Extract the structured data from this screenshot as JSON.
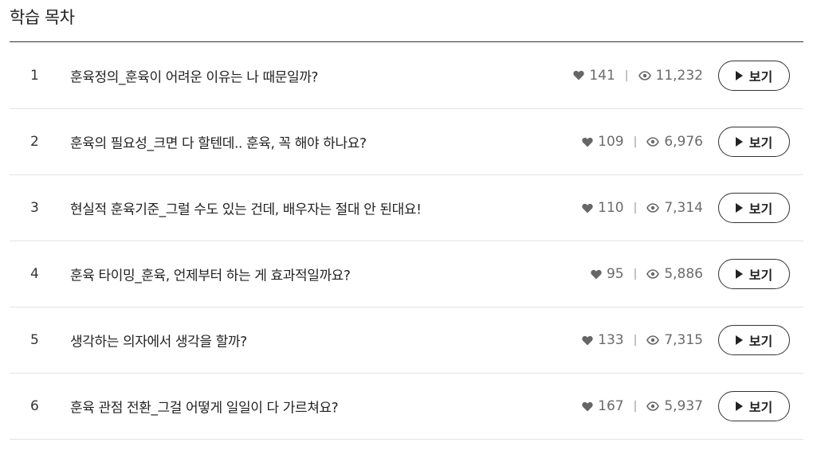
{
  "section": {
    "title": "학습 목차"
  },
  "lessons": [
    {
      "number": "1",
      "title": "훈육정의_훈육이 어려운 이유는 나 때문일까?",
      "likes": "141",
      "views": "11,232",
      "button_label": "보기"
    },
    {
      "number": "2",
      "title": "훈육의 필요성_크면 다 할텐데.. 훈육, 꼭 해야 하나요?",
      "likes": "109",
      "views": "6,976",
      "button_label": "보기"
    },
    {
      "number": "3",
      "title": "현실적 훈육기준_그럴 수도 있는 건데, 배우자는 절대 안 된대요!",
      "likes": "110",
      "views": "7,314",
      "button_label": "보기"
    },
    {
      "number": "4",
      "title": "훈육 타이밍_훈육, 언제부터 하는 게 효과적일까요?",
      "likes": "95",
      "views": "5,886",
      "button_label": "보기"
    },
    {
      "number": "5",
      "title": "생각하는 의자에서 생각을 할까?",
      "likes": "133",
      "views": "7,315",
      "button_label": "보기"
    },
    {
      "number": "6",
      "title": "훈육 관점 전환_그걸 어떻게 일일이 다 가르쳐요?",
      "likes": "167",
      "views": "5,937",
      "button_label": "보기"
    }
  ],
  "icons": {
    "like": "heart-icon",
    "views": "eye-icon",
    "play": "play-icon"
  },
  "colors": {
    "text": "#222222",
    "stats": "#6b6b6b",
    "divider": "#e3e3e3",
    "header_rule": "#333333"
  }
}
